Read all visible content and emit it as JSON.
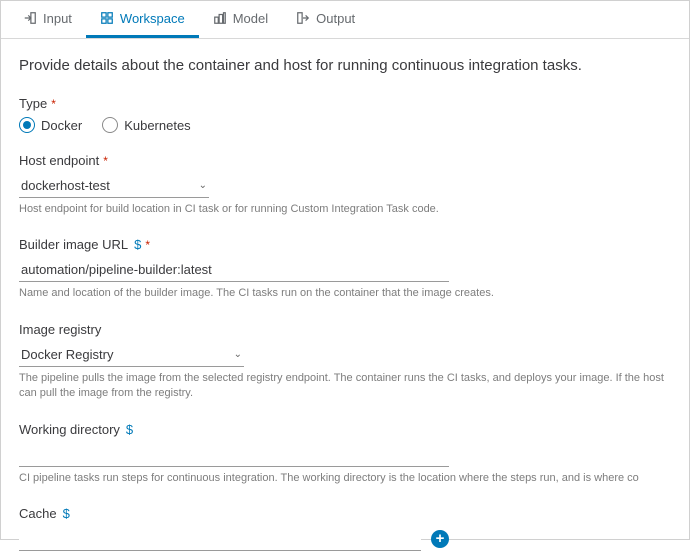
{
  "tabs": {
    "input": "Input",
    "workspace": "Workspace",
    "model": "Model",
    "output": "Output"
  },
  "heading": "Provide details about the container and host for running continuous integration tasks.",
  "type": {
    "label": "Type",
    "options": {
      "docker": "Docker",
      "kubernetes": "Kubernetes"
    }
  },
  "hostEndpoint": {
    "label": "Host endpoint",
    "value": "dockerhost-test",
    "helper": "Host endpoint for build location in CI task or for running Custom Integration Task code."
  },
  "builderImage": {
    "label": "Builder image URL",
    "value": "automation/pipeline-builder:latest",
    "helper": "Name and location of the builder image. The CI tasks run on the container that the image creates."
  },
  "imageRegistry": {
    "label": "Image registry",
    "value": "Docker Registry",
    "helper": "The pipeline pulls the image from the selected registry endpoint. The container runs the CI tasks, and deploys your image. If the host can pull the image from the registry."
  },
  "workingDirectory": {
    "label": "Working directory",
    "helper": "CI pipeline tasks run steps for continuous integration. The working directory is the location where the steps run, and is where co"
  },
  "cache": {
    "label": "Cache"
  }
}
